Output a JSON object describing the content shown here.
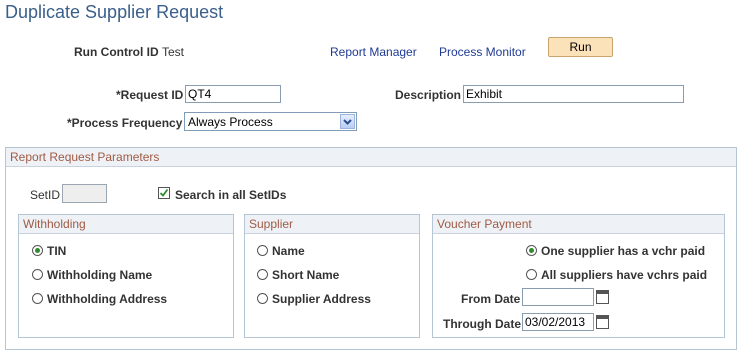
{
  "page": {
    "title": "Duplicate Supplier Request"
  },
  "run_control": {
    "label": "Run Control ID",
    "value": "Test",
    "report_manager_link": "Report Manager",
    "process_monitor_link": "Process Monitor",
    "run_button": "Run"
  },
  "request": {
    "request_id_label": "*Request ID",
    "request_id_value": "QT4",
    "description_label": "Description",
    "description_value": "Exhibit",
    "frequency_label": "*Process Frequency",
    "frequency_value": "Always Process"
  },
  "params": {
    "section_title": "Report Request Parameters",
    "setid_label": "SetID",
    "setid_value": "",
    "search_all_label": "Search in all SetIDs",
    "search_all_checked": true
  },
  "withholding": {
    "title": "Withholding",
    "options": [
      "TIN",
      "Withholding Name",
      "Withholding Address"
    ],
    "selected": "TIN"
  },
  "supplier": {
    "title": "Supplier",
    "options": [
      "Name",
      "Short Name",
      "Supplier Address"
    ],
    "selected": ""
  },
  "voucher": {
    "title": "Voucher Payment",
    "options": [
      "One supplier has a vchr paid",
      "All suppliers have vchrs paid"
    ],
    "selected": "One supplier has a vchr paid",
    "from_date_label": "From Date",
    "from_date_value": "",
    "through_date_label": "Through Date",
    "through_date_value": "03/02/2013"
  },
  "colors": {
    "title": "#3a5f8a",
    "link": "#1f3a93",
    "section_header_text": "#a05a44",
    "button_bg": "#fbe2b9",
    "radio_selected": "#2e8b2e"
  }
}
